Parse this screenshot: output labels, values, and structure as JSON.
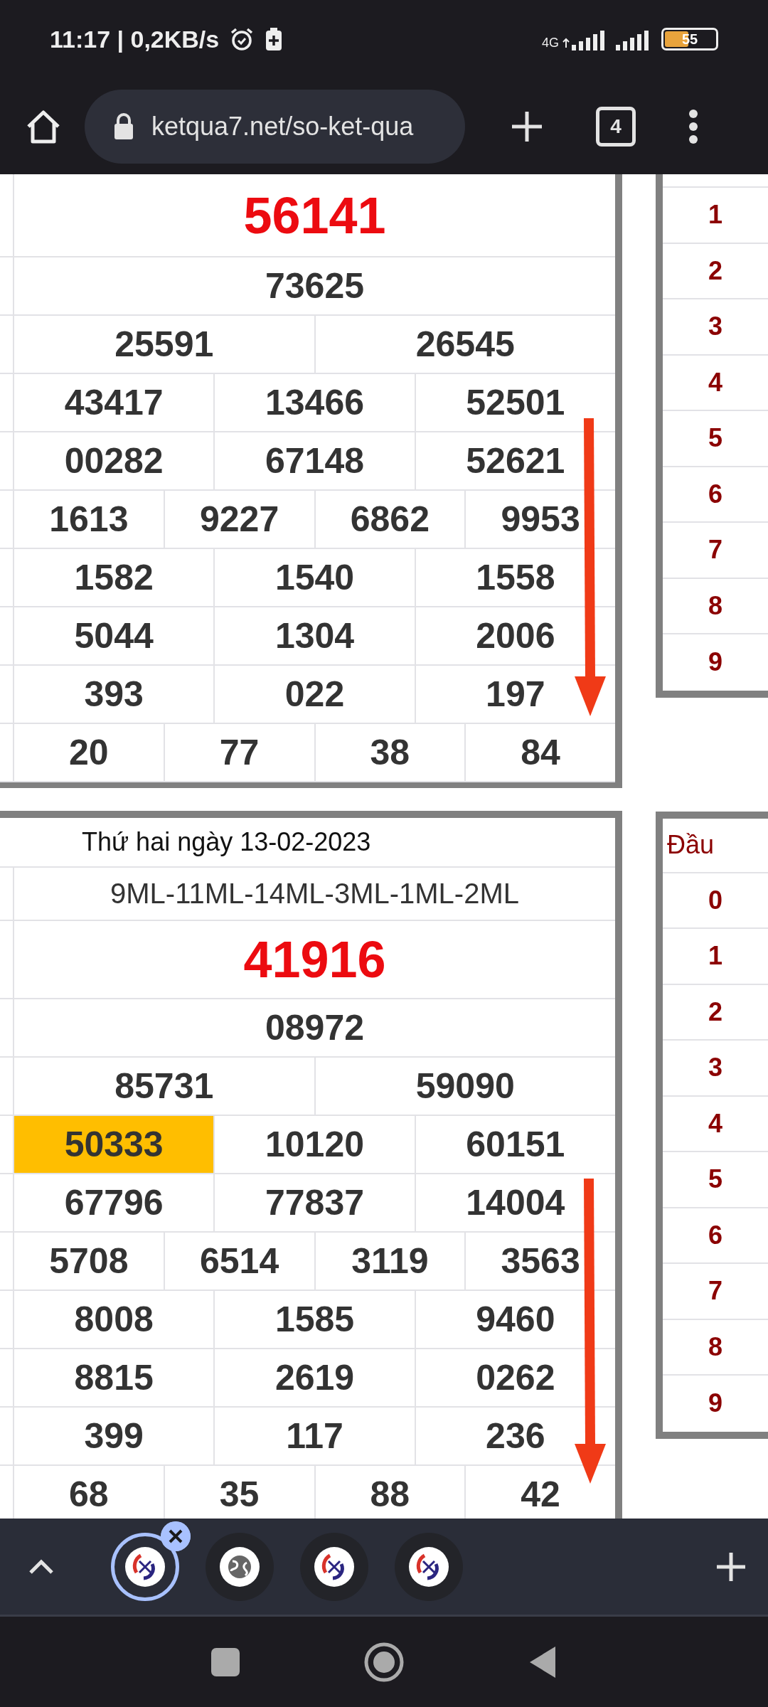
{
  "status_bar": {
    "time": "11:17 | 0,2KB/s",
    "network": "4G",
    "battery": "55"
  },
  "browser": {
    "url": "ketqua7.net/so-ket-qua",
    "tab_count": "4"
  },
  "results": [
    {
      "annotations": [
        {
          "kind": "arrow"
        }
      ],
      "rows": [
        {
          "kind": "special",
          "cells": [
            {
              "value": "56141",
              "highlighted": false
            }
          ]
        },
        {
          "kind": "numbers",
          "cells": [
            {
              "value": "73625",
              "highlighted": false
            }
          ]
        },
        {
          "kind": "numbers",
          "cells": [
            {
              "value": "25591",
              "highlighted": false
            },
            {
              "value": "26545",
              "highlighted": false
            }
          ]
        },
        {
          "kind": "numbers",
          "cells": [
            {
              "value": "43417",
              "highlighted": false
            },
            {
              "value": "13466",
              "highlighted": false
            },
            {
              "value": "52501",
              "highlighted": false
            }
          ]
        },
        {
          "kind": "numbers",
          "cells": [
            {
              "value": "00282",
              "highlighted": false
            },
            {
              "value": "67148",
              "highlighted": false
            },
            {
              "value": "52621",
              "highlighted": false
            }
          ]
        },
        {
          "kind": "numbers",
          "cells": [
            {
              "value": "1613",
              "highlighted": false
            },
            {
              "value": "9227",
              "highlighted": false
            },
            {
              "value": "6862",
              "highlighted": false
            },
            {
              "value": "9953",
              "highlighted": false
            }
          ]
        },
        {
          "kind": "numbers",
          "cells": [
            {
              "value": "1582",
              "highlighted": false
            },
            {
              "value": "1540",
              "highlighted": false
            },
            {
              "value": "1558",
              "highlighted": false
            }
          ]
        },
        {
          "kind": "numbers",
          "cells": [
            {
              "value": "5044",
              "highlighted": false
            },
            {
              "value": "1304",
              "highlighted": false
            },
            {
              "value": "2006",
              "highlighted": false
            }
          ]
        },
        {
          "kind": "numbers",
          "cells": [
            {
              "value": "393",
              "highlighted": false
            },
            {
              "value": "022",
              "highlighted": false
            },
            {
              "value": "197",
              "highlighted": false
            }
          ]
        },
        {
          "kind": "numbers",
          "cells": [
            {
              "value": "20",
              "highlighted": false
            },
            {
              "value": "77",
              "highlighted": false
            },
            {
              "value": "38",
              "highlighted": false
            },
            {
              "value": "84",
              "highlighted": false
            }
          ]
        }
      ]
    },
    {
      "annotations": [
        {
          "kind": "arrow"
        }
      ],
      "rows": [
        {
          "kind": "date",
          "text": "Thứ hai ngày 13-02-2023"
        },
        {
          "kind": "code",
          "text": "9ML-11ML-14ML-3ML-1ML-2ML"
        },
        {
          "kind": "special",
          "cells": [
            {
              "value": "41916",
              "highlighted": false
            }
          ]
        },
        {
          "kind": "numbers",
          "cells": [
            {
              "value": "08972",
              "highlighted": false
            }
          ]
        },
        {
          "kind": "numbers",
          "cells": [
            {
              "value": "85731",
              "highlighted": false
            },
            {
              "value": "59090",
              "highlighted": false
            }
          ]
        },
        {
          "kind": "numbers",
          "cells": [
            {
              "value": "50333",
              "highlighted": true
            },
            {
              "value": "10120",
              "highlighted": false
            },
            {
              "value": "60151",
              "highlighted": false
            }
          ]
        },
        {
          "kind": "numbers",
          "cells": [
            {
              "value": "67796",
              "highlighted": false
            },
            {
              "value": "77837",
              "highlighted": false
            },
            {
              "value": "14004",
              "highlighted": false
            }
          ]
        },
        {
          "kind": "numbers",
          "cells": [
            {
              "value": "5708",
              "highlighted": false
            },
            {
              "value": "6514",
              "highlighted": false
            },
            {
              "value": "3119",
              "highlighted": false
            },
            {
              "value": "3563",
              "highlighted": false
            }
          ]
        },
        {
          "kind": "numbers",
          "cells": [
            {
              "value": "8008",
              "highlighted": false
            },
            {
              "value": "1585",
              "highlighted": false
            },
            {
              "value": "9460",
              "highlighted": false
            }
          ]
        },
        {
          "kind": "numbers",
          "cells": [
            {
              "value": "8815",
              "highlighted": false
            },
            {
              "value": "2619",
              "highlighted": false
            },
            {
              "value": "0262",
              "highlighted": false
            }
          ]
        },
        {
          "kind": "numbers",
          "cells": [
            {
              "value": "399",
              "highlighted": false
            },
            {
              "value": "117",
              "highlighted": false
            },
            {
              "value": "236",
              "highlighted": false
            }
          ]
        },
        {
          "kind": "numbers",
          "cells": [
            {
              "value": "68",
              "highlighted": false
            },
            {
              "value": "35",
              "highlighted": false
            },
            {
              "value": "88",
              "highlighted": false
            },
            {
              "value": "42",
              "highlighted": false
            }
          ]
        }
      ]
    }
  ],
  "loto": [
    {
      "rows": [
        "1",
        "2",
        "3",
        "4",
        "5",
        "6",
        "7",
        "8",
        "9"
      ]
    },
    {
      "header": "Đầu",
      "rows": [
        "0",
        "1",
        "2",
        "3",
        "4",
        "5",
        "6",
        "7",
        "8",
        "9"
      ]
    }
  ],
  "tab_strip": {
    "tabs": [
      {
        "kind": "site",
        "selected": true
      },
      {
        "kind": "globe",
        "selected": false
      },
      {
        "kind": "site",
        "selected": false
      },
      {
        "kind": "site",
        "selected": false
      }
    ]
  }
}
